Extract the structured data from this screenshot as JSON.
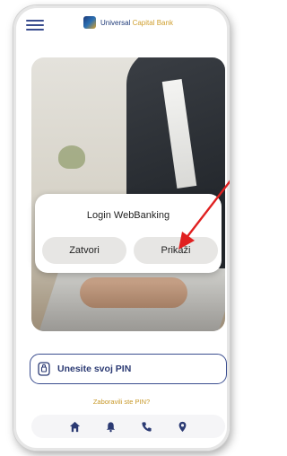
{
  "header": {
    "brand_name": "Universal",
    "brand_accent": "Capital Bank",
    "brand_color": "#1e3a78",
    "accent_color": "#d0a030"
  },
  "dialog": {
    "title": "Login WebBanking",
    "close_label": "Zatvori",
    "show_label": "Prikaži"
  },
  "login": {
    "pin_placeholder": "Unesite svoj PIN",
    "forgot_pin": "Zaboravili ste PIN?"
  },
  "nav": {
    "items": [
      "home-icon",
      "bell-icon",
      "phone-icon",
      "location-pin-icon"
    ]
  },
  "annotation": {
    "arrow_color": "#e02020"
  }
}
